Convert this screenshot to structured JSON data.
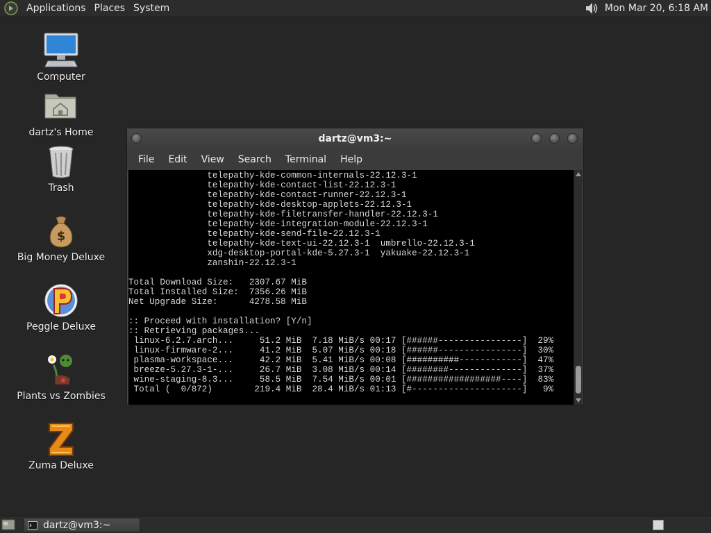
{
  "top_panel": {
    "menus": [
      "Applications",
      "Places",
      "System"
    ],
    "clock": "Mon Mar 20,  6:18 AM",
    "icons": {
      "logo": "gnome-foot-icon",
      "volume": "volume-icon"
    }
  },
  "desktop": {
    "icons": [
      {
        "label": "Computer",
        "icon": "computer-icon"
      },
      {
        "label": "dartz's Home",
        "icon": "home-folder-icon"
      },
      {
        "label": "Trash",
        "icon": "trash-icon"
      },
      {
        "label": "Big Money Deluxe",
        "icon": "money-bag-icon"
      },
      {
        "label": "Peggle Deluxe",
        "icon": "peggle-icon"
      },
      {
        "label": "Plants vs Zombies",
        "icon": "plants-vs-zombies-icon"
      },
      {
        "label": "Zuma Deluxe",
        "icon": "zuma-icon"
      }
    ]
  },
  "terminal": {
    "title": "dartz@vm3:~",
    "menu": [
      "File",
      "Edit",
      "View",
      "Search",
      "Terminal",
      "Help"
    ],
    "lines": [
      "               telepathy-kde-common-internals-22.12.3-1",
      "               telepathy-kde-contact-list-22.12.3-1",
      "               telepathy-kde-contact-runner-22.12.3-1",
      "               telepathy-kde-desktop-applets-22.12.3-1",
      "               telepathy-kde-filetransfer-handler-22.12.3-1",
      "               telepathy-kde-integration-module-22.12.3-1",
      "               telepathy-kde-send-file-22.12.3-1",
      "               telepathy-kde-text-ui-22.12.3-1  umbrello-22.12.3-1",
      "               xdg-desktop-portal-kde-5.27.3-1  yakuake-22.12.3-1",
      "               zanshin-22.12.3-1",
      "",
      "Total Download Size:   2307.67 MiB",
      "Total Installed Size:  7356.26 MiB",
      "Net Upgrade Size:      4278.58 MiB",
      "",
      ":: Proceed with installation? [Y/n]",
      ":: Retrieving packages...",
      " linux-6.2.7.arch...     51.2 MiB  7.18 MiB/s 00:17 [######----------------]  29%",
      " linux-firmware-2...     41.2 MiB  5.07 MiB/s 00:18 [######----------------]  30%",
      " plasma-workspace...     42.2 MiB  5.41 MiB/s 00:08 [##########------------]  47%",
      " breeze-5.27.3-1-...     26.7 MiB  3.08 MiB/s 00:14 [########--------------]  37%",
      " wine-staging-8.3...     58.5 MiB  7.54 MiB/s 00:01 [##################----]  83%",
      " Total (  0/872)        219.4 MiB  28.4 MiB/s 01:13 [#---------------------]   9%"
    ]
  },
  "bottom_panel": {
    "task": "dartz@vm3:~",
    "icons": {
      "show_desktop": "show-desktop-icon",
      "terminal": "terminal-icon"
    }
  }
}
